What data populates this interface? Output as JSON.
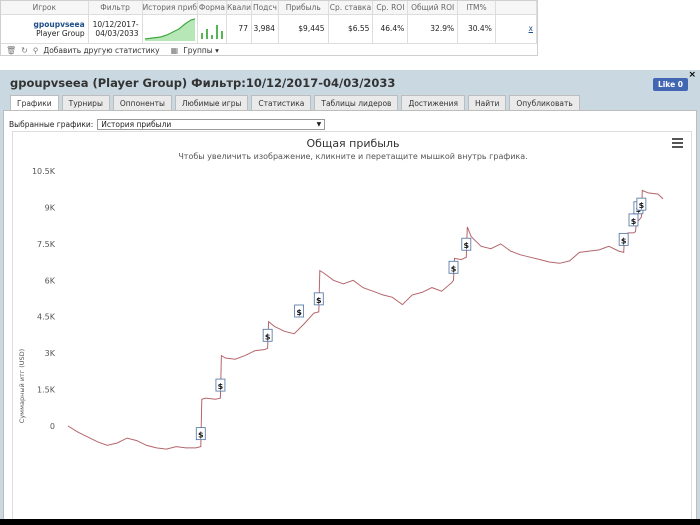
{
  "stats": {
    "headers": [
      "Игрок",
      "Фильтр",
      "История приб",
      "Форма",
      "Квали",
      "Подсч",
      "Прибыль",
      "Ср. ставка",
      "Ср. ROI",
      "Общий ROI",
      "ITM%"
    ],
    "row": {
      "player_name": "gpoupvseea",
      "player_group": "Player Group",
      "filter_line1": "10/12/2017-",
      "filter_line2": "04/03/2033",
      "qual": "77",
      "count": "3,984",
      "profit": "$9,445",
      "avg_stake": "$6.55",
      "avg_roi": "46.4%",
      "total_roi": "32.9%",
      "itm": "30.4%",
      "remove": "x"
    },
    "footer": {
      "add_label": "Добавить другую статистику",
      "groups_label": "Группы"
    }
  },
  "panel": {
    "title": "gpoupvseea (Player Group) Фильтр:10/12/2017-04/03/2033",
    "close": "×",
    "fb_like": "Like 0",
    "tabs": [
      "Графики",
      "Турниры",
      "Оппоненты",
      "Любимые игры",
      "Статистика",
      "Таблицы лидеров",
      "Достижения",
      "Найти",
      "Опубликовать"
    ],
    "active_tab": 0,
    "graph_select_label": "Выбранные графики:",
    "graph_select_value": "История прибыли"
  },
  "chart_data": {
    "type": "line",
    "title": "Общая прибыль",
    "subtitle": "Чтобы увеличить изображение, кликните и перетащите мышкой внутрь графика.",
    "ylabel": "Суммарный итг (USD)",
    "xlabel": "",
    "ylim": [
      -900,
      10500
    ],
    "yticks": [
      "0",
      "1.5K",
      "3K",
      "4.5K",
      "6K",
      "7.5K",
      "9K",
      "10.5K"
    ],
    "ytick_values": [
      0,
      1500,
      3000,
      4500,
      6000,
      7500,
      9000,
      10500
    ],
    "grid": false,
    "line_color": "#b5656b",
    "marker_label": "$",
    "series": [
      {
        "x": [
          0,
          10,
          20,
          30,
          40,
          50,
          60,
          70,
          80,
          90,
          100,
          110,
          120,
          130,
          135,
          136,
          140,
          150,
          155,
          156,
          160,
          170,
          180,
          190,
          200,
          203,
          204,
          210,
          220,
          230,
          240,
          250,
          255,
          256,
          260,
          270,
          280,
          290,
          300,
          310,
          320,
          330,
          340,
          350,
          360,
          370,
          380,
          390,
          392,
          393,
          400,
          405,
          406,
          410,
          420,
          430,
          440,
          450,
          460,
          470,
          480,
          490,
          500,
          510,
          520,
          530,
          540,
          550,
          560,
          565,
          566,
          570,
          575,
          577,
          578,
          580,
          583,
          584,
          590,
          600,
          605
        ],
        "y": [
          0,
          -250,
          -450,
          -650,
          -800,
          -700,
          -500,
          -600,
          -800,
          -900,
          -950,
          -850,
          -900,
          -900,
          -850,
          1100,
          1150,
          1100,
          1150,
          2900,
          2800,
          2750,
          2900,
          3100,
          3150,
          3200,
          4300,
          4100,
          3900,
          3800,
          4200,
          4650,
          4700,
          6400,
          6300,
          6000,
          5850,
          6000,
          5700,
          5550,
          5400,
          5300,
          5000,
          5400,
          5500,
          5700,
          5550,
          5900,
          6000,
          6900,
          6850,
          6950,
          8200,
          7800,
          7400,
          7300,
          7500,
          7200,
          7050,
          6950,
          6850,
          6750,
          6700,
          6800,
          7150,
          7200,
          7250,
          7400,
          7200,
          7150,
          7900,
          7950,
          7950,
          8000,
          8400,
          8450,
          8600,
          9700,
          9600,
          9550,
          9350
        ]
      }
    ],
    "markers_at_x": [
      135,
      155,
      203,
      235,
      255,
      392,
      405,
      565,
      575,
      580,
      583
    ]
  }
}
